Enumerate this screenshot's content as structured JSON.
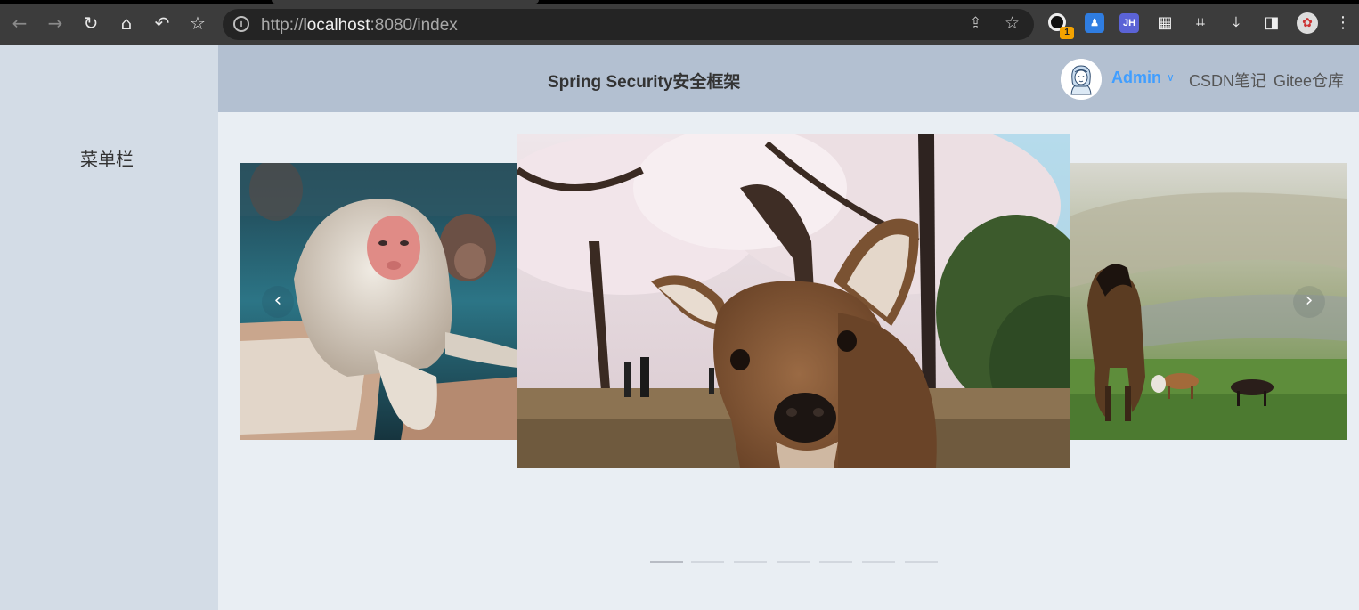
{
  "browser": {
    "url_host": "localhost",
    "url_prefix": "http://",
    "url_suffix": ":8080/index",
    "ext_badge": "1",
    "ext_jh": "JH"
  },
  "sidebar": {
    "title": "菜单栏"
  },
  "header": {
    "title": "Spring Security安全框架",
    "user": "Admin",
    "links": [
      "CSDN笔记",
      "Gitee仓库"
    ]
  },
  "carousel": {
    "slides": [
      "snow-monkey",
      "deer",
      "horses"
    ],
    "active_index": 0,
    "indicator_count": 7
  }
}
